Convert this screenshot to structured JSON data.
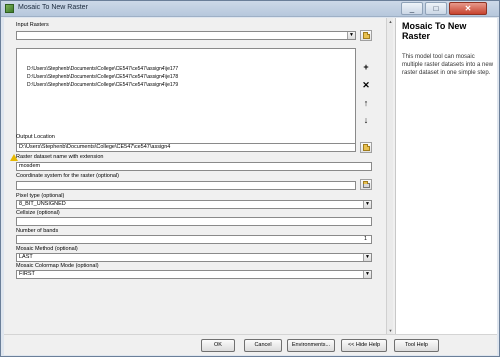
{
  "window": {
    "title": "Mosaic To New Raster"
  },
  "form": {
    "input_rasters_label": "Input Rasters",
    "input_rasters_value": "",
    "input_rasters_list": [
      "D:\\Users\\Stephenb\\Documents\\College\\CE547\\ce547\\assign4\\je177",
      "D:\\Users\\Stephenb\\Documents\\College\\CE547\\ce547\\assign4\\je178",
      "D:\\Users\\Stephenb\\Documents\\College\\CE547\\ce547\\assign4\\je179"
    ],
    "output_location_label": "Output Location",
    "output_location_value": "D:\\Users\\Stephenb\\Documents\\College\\CE547\\ce547\\assign4",
    "raster_name_label": "Raster dataset name with extension",
    "raster_name_value": "mosdem",
    "coord_system_label": "Coordinate system for the raster (optional)",
    "coord_system_value": "",
    "pixel_type_label": "Pixel type (optional)",
    "pixel_type_value": "8_BIT_UNSIGNED",
    "cellsize_label": "Cellsize (optional)",
    "cellsize_value": "",
    "bands_label": "Number of bands",
    "bands_value": "1",
    "mosaic_method_label": "Mosaic Method (optional)",
    "mosaic_method_value": "LAST",
    "colormap_label": "Mosaic Colormap Mode (optional)",
    "colormap_value": "FIRST"
  },
  "side_buttons": {
    "add": "+",
    "remove": "✕",
    "up": "↑",
    "down": "↓"
  },
  "help": {
    "title": "Mosaic To New Raster",
    "text": "This model tool can mosaic multiple raster datasets into a new raster dataset in one simple step."
  },
  "buttons": {
    "ok": "OK",
    "cancel": "Cancel",
    "environments": "Environments...",
    "hide_help": "<< Hide Help",
    "tool_help": "Tool Help"
  },
  "colors": {
    "title_bar": "#b6c7dc",
    "close_button": "#c7432f",
    "warning": "#e6b800"
  },
  "icons": [
    "app-icon",
    "minimize-icon",
    "maximize-icon",
    "close-icon",
    "folder-icon",
    "add-icon",
    "remove-icon",
    "move-up-icon",
    "move-down-icon",
    "warning-icon"
  ]
}
